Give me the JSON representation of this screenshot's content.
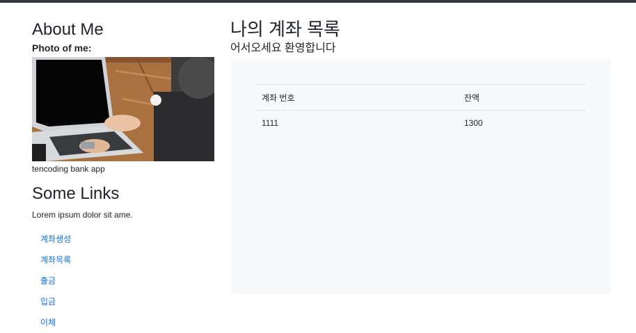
{
  "sidebar": {
    "title": "About Me",
    "photo_label": "Photo of me:",
    "caption": "tencoding bank app",
    "links_title": "Some Links",
    "lorem": "Lorem ipsum dolor sit ame.",
    "links": [
      {
        "label": "계좌생성"
      },
      {
        "label": "계좌목록"
      },
      {
        "label": "출금"
      },
      {
        "label": "입금"
      },
      {
        "label": "이체"
      }
    ]
  },
  "main": {
    "title": "나의 계좌 목록",
    "welcome": "어서오세요 환영합니다",
    "table": {
      "headers": [
        "계좌 번호",
        "잔액"
      ],
      "rows": [
        [
          "1111",
          "1300"
        ]
      ]
    }
  },
  "colors": {
    "topbar": "#343a40",
    "link": "#0d6efd",
    "panel": "#f8f9fa"
  }
}
